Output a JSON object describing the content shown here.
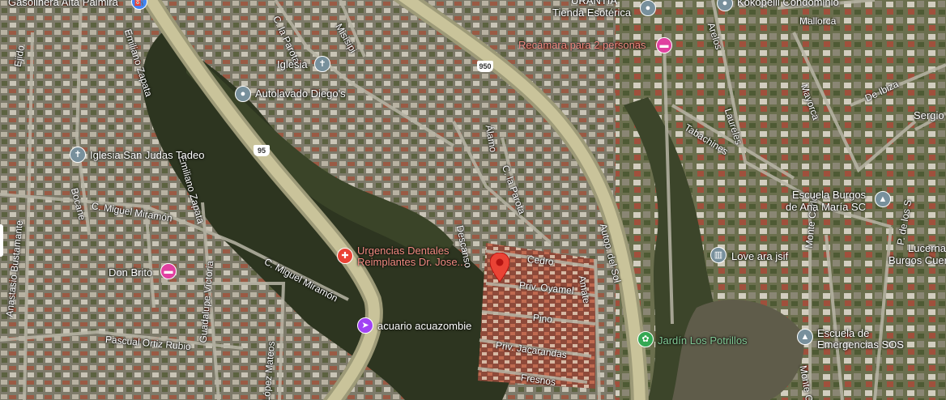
{
  "map": {
    "places": [
      {
        "id": "gasolinera",
        "label": "Gasolinera Alta Palmira",
        "icon": "fuel-icon"
      },
      {
        "id": "urantia",
        "label": "URANTIA",
        "icon": ""
      },
      {
        "id": "tienda",
        "label": "Tienda Esotérica",
        "icon": "place-icon"
      },
      {
        "id": "kokopelli",
        "label": "Kokopelli Condominio",
        "icon": "place-icon"
      },
      {
        "id": "recamara",
        "label": "Recámara para 2 personas",
        "icon": "hotel-icon"
      },
      {
        "id": "iglesia",
        "label": "Iglesia",
        "icon": "church-icon"
      },
      {
        "id": "autolavado",
        "label": "Autolavado Diego's",
        "icon": "place-icon"
      },
      {
        "id": "iglesia_sj",
        "label": "Iglesia San Judas Tadeo",
        "icon": "church-icon"
      },
      {
        "id": "urgencias",
        "label_line1": "Urgencias Dentales",
        "label_line2": "Reimplantes Dr. Jose...",
        "icon": "hospital-icon"
      },
      {
        "id": "donbrito",
        "label": "Don Brito",
        "icon": "hotel-icon"
      },
      {
        "id": "acuario",
        "label": "acuario acuazombie",
        "icon": "aquarium-icon"
      },
      {
        "id": "jardin",
        "label": "Jardín Los Potrillos",
        "icon": "garden-icon"
      },
      {
        "id": "escuela_burgos",
        "label_line1": "Escuela Burgos",
        "label_line2": "de Ana María SC",
        "icon": "school-icon"
      },
      {
        "id": "love",
        "label": "Love ara jsif",
        "icon": "building-icon"
      },
      {
        "id": "lucerna",
        "label_line1": "Lucerna",
        "label_line2": "Burgos Cuernava",
        "icon": ""
      },
      {
        "id": "escuela_sos",
        "label_line1": "Escuela de",
        "label_line2": "Emergencias SOS",
        "icon": "school-icon"
      },
      {
        "id": "sergio",
        "label": "Sergio",
        "icon": ""
      }
    ],
    "roads": {
      "mallorca": "Mallorca",
      "emiliano1": "Emiliano Zapata",
      "emiliano2": "Emiliano Zapata",
      "laparota1": "C. la Parota",
      "laparota2": "C. la Parota",
      "misisipi": "Misisipi",
      "ejido": "Ejido",
      "bocane": "Bocane",
      "miramon1": "C. Miguel Miramón",
      "miramon2": "C. Miguel Miramón",
      "anastasio": "Anastasio Bustamante",
      "guadalupe": "Guadalupe Victoria",
      "pascual": "Pascual Ortiz Rubio",
      "lopez": "López Mateos",
      "alamo": "Álamo",
      "descanso": "Descanso",
      "cedro": "Cedro",
      "oyamel": "Priv. Oyamel",
      "pino": "Pino",
      "jacarandas": "Priv. Jacarandas",
      "fresnos": "Fresnos",
      "amate": "Amate",
      "autopista": "Autop. del Sol",
      "arelos": "Arelos",
      "laureles": "Laureles",
      "tabachines": "Tabachines",
      "mayorca": "Mayorca",
      "deibiza": "De Ibiza",
      "montecarlo": "Monte Carlo",
      "montecarlo2": "Monte C",
      "pdelos": "P. de los S"
    },
    "shields": {
      "s950": "950",
      "s95": "95"
    },
    "selected_pin": {
      "icon": "location-pin-icon",
      "color": "#ea4335"
    }
  }
}
